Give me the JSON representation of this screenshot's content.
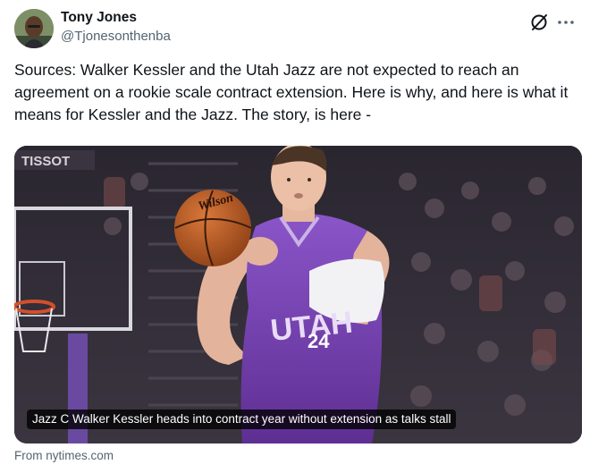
{
  "author": {
    "display_name": "Tony Jones",
    "handle": "@Tjonesonthenba"
  },
  "header_icons": {
    "grok": "grok-slash-circle-icon",
    "more": "more-dots-icon"
  },
  "tweet": {
    "text": "Sources: Walker Kessler and the Utah Jazz are not expected to reach an agreement on a rookie scale contract extension. Here is why, and here is what it means for Kessler and the Jazz. The story, is here -"
  },
  "card": {
    "headline": "Jazz C Walker Kessler heads into contract year without extension as talks stall",
    "source": "From nytimes.com",
    "image": {
      "jersey_text": "UTAH",
      "jersey_number": "24",
      "ball_brand": "Wilson",
      "sign_text": "TISSOT"
    }
  },
  "colors": {
    "text_primary": "#0f1419",
    "text_secondary": "#536471",
    "jersey_purple": "#7b45b8"
  }
}
